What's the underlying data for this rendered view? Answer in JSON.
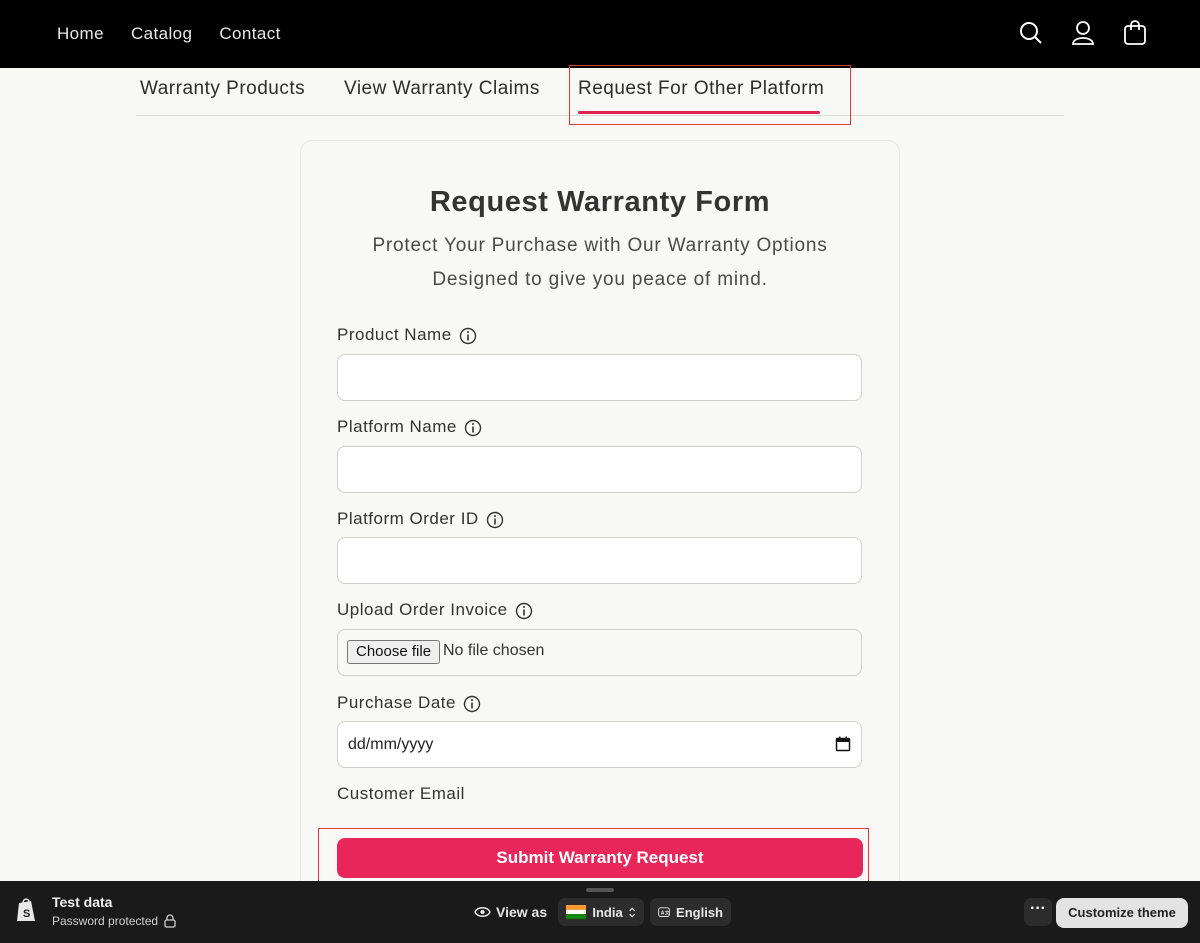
{
  "header": {
    "nav": [
      "Home",
      "Catalog",
      "Contact"
    ],
    "icons": [
      "search-icon",
      "account-icon",
      "cart-icon"
    ],
    "background": "#000000"
  },
  "tabs": {
    "items": [
      "Warranty Products",
      "View Warranty Claims",
      "Request For Other Platform"
    ],
    "active_index": 2,
    "accent": "#e1214f"
  },
  "form": {
    "title": "Request Warranty Form",
    "subtitle_line1": "Protect Your Purchase with Our Warranty Options",
    "subtitle_line2": "Designed to give you peace of mind.",
    "fields": {
      "product_name": {
        "label": "Product Name",
        "value": ""
      },
      "platform_name": {
        "label": "Platform Name",
        "value": ""
      },
      "platform_order_id": {
        "label": "Platform Order ID",
        "value": ""
      },
      "upload_invoice": {
        "label": "Upload Order Invoice",
        "button": "Choose file",
        "status": "No file chosen"
      },
      "purchase_date": {
        "label": "Purchase Date",
        "placeholder": "dd/mm/yyyy"
      },
      "customer_email": {
        "label": "Customer Email"
      }
    },
    "submit_label": "Submit Warranty Request",
    "submit_color": "#e8265a"
  },
  "bottom_bar": {
    "store_name": "Test data",
    "store_status": "Password protected",
    "view_as_label": "View as",
    "country": "India",
    "language": "English",
    "more_label": "···",
    "customize_label": "Customize theme"
  }
}
